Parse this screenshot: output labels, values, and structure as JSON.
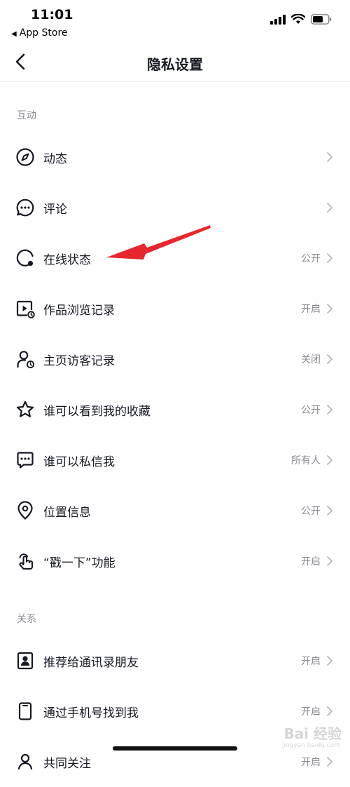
{
  "status": {
    "time": "11:01",
    "back_app": "App Store"
  },
  "nav": {
    "title": "隐私设置"
  },
  "sections": {
    "interaction": "互动",
    "relations": "关系"
  },
  "rows": [
    {
      "label": "动态",
      "value": "",
      "icon": "compass-icon"
    },
    {
      "label": "评论",
      "value": "",
      "icon": "comment-bubble-icon"
    },
    {
      "label": "在线状态",
      "value": "公开",
      "icon": "online-status-icon"
    },
    {
      "label": "作品浏览记录",
      "value": "开启",
      "icon": "video-history-icon"
    },
    {
      "label": "主页访客记录",
      "value": "关闭",
      "icon": "visitor-icon"
    },
    {
      "label": "谁可以看到我的收藏",
      "value": "公开",
      "icon": "star-icon"
    },
    {
      "label": "谁可以私信我",
      "value": "所有人",
      "icon": "message-icon"
    },
    {
      "label": "位置信息",
      "value": "公开",
      "icon": "location-pin-icon"
    },
    {
      "label": "“戳一下”功能",
      "value": "开启",
      "icon": "poke-hand-icon"
    },
    {
      "label": "推荐给通讯录朋友",
      "value": "开启",
      "icon": "contact-card-icon"
    },
    {
      "label": "通过手机号找到我",
      "value": "开启",
      "icon": "phone-icon"
    },
    {
      "label": "共同关注",
      "value": "开启",
      "icon": "people-icon"
    }
  ],
  "watermark": {
    "text": "Bai 经验",
    "sub": "jingyan.baidu.com"
  },
  "colors": {
    "text": "#161823",
    "secondary": "#8a8b91",
    "arrow": "#e8262d"
  }
}
